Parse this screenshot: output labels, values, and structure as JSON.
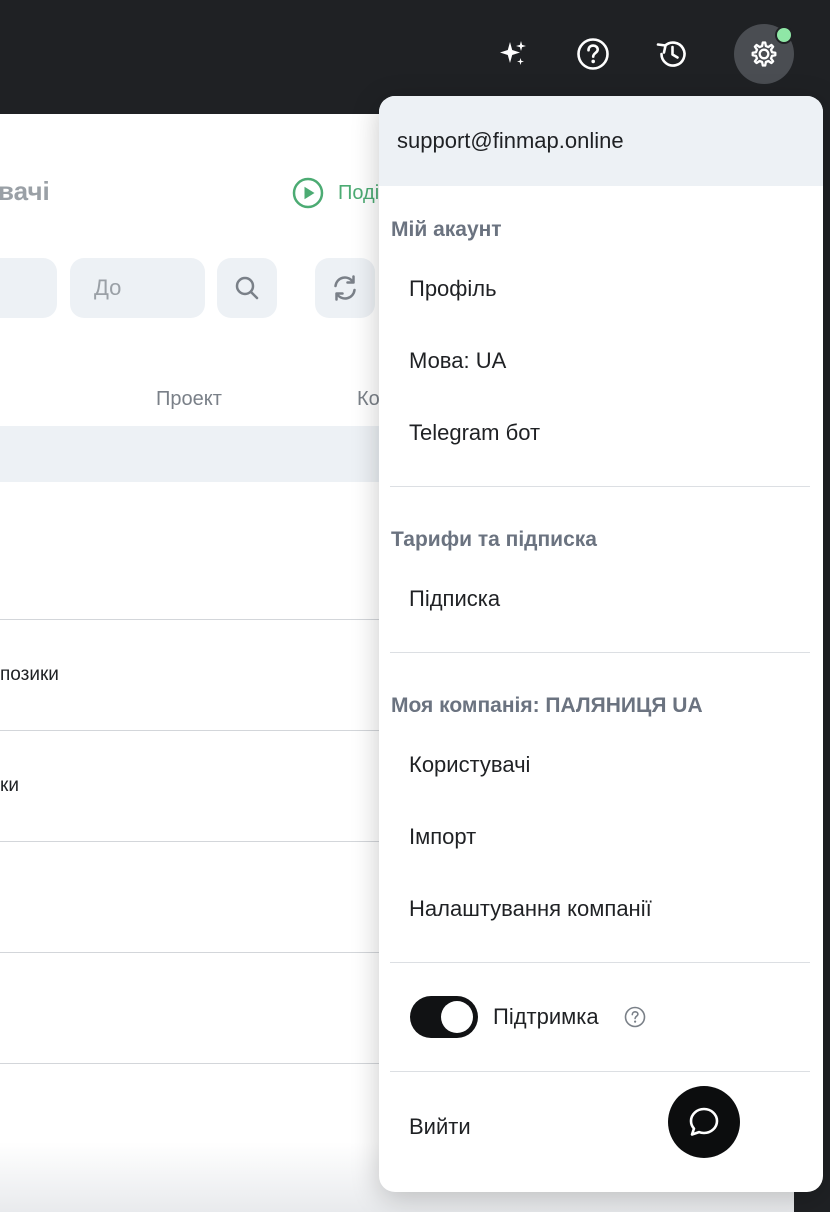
{
  "topbar": {
    "icons": [
      "sparkles-icon",
      "help-circle-icon",
      "history-icon",
      "gear-icon"
    ],
    "notify_color": "#8fe7a6"
  },
  "main": {
    "page_title": "вачі",
    "tutorial_label": "Поді",
    "filter_to_placeholder": "До",
    "columns": [
      "Проект",
      "Ко"
    ],
    "rows": [
      "позики",
      "ки"
    ]
  },
  "menu": {
    "email": "support@finmap.online",
    "account_section": "Мій акаунт",
    "account_items": [
      "Профіль",
      "Мова: UA",
      "Telegram бот"
    ],
    "plans_section": "Тарифи та підписка",
    "plans_items": [
      "Підписка"
    ],
    "company_section": "Моя компанія: ПАЛЯНИЦЯ UA",
    "company_items": [
      "Користувачі",
      "Імпорт",
      "Налаштування компанії"
    ],
    "support_label": "Підтримка",
    "support_enabled": true,
    "logout_label": "Вийти"
  },
  "colors": {
    "accent_green": "#4cab73",
    "topbar_bg": "#1f2124",
    "toggle_on": "#111214"
  }
}
